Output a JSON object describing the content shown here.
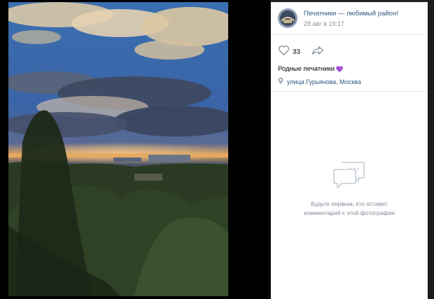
{
  "post": {
    "author": "Печатники — любимый район!",
    "date": "28 авг в 19:17",
    "likes": "33",
    "caption": "Родные печатники",
    "location": "улица Гурьянова, Москва"
  },
  "comments": {
    "empty_line1": "Будьте первым, кто оставит",
    "empty_line2": "комментарий к этой фотографии"
  },
  "colors": {
    "link": "#2a5885",
    "muted": "#939393",
    "heart_emoji": "#a64ed8"
  },
  "icons": {
    "like": "heart-icon",
    "share": "share-arrow-icon",
    "location": "location-pin-icon",
    "comments": "speech-bubbles-icon"
  }
}
